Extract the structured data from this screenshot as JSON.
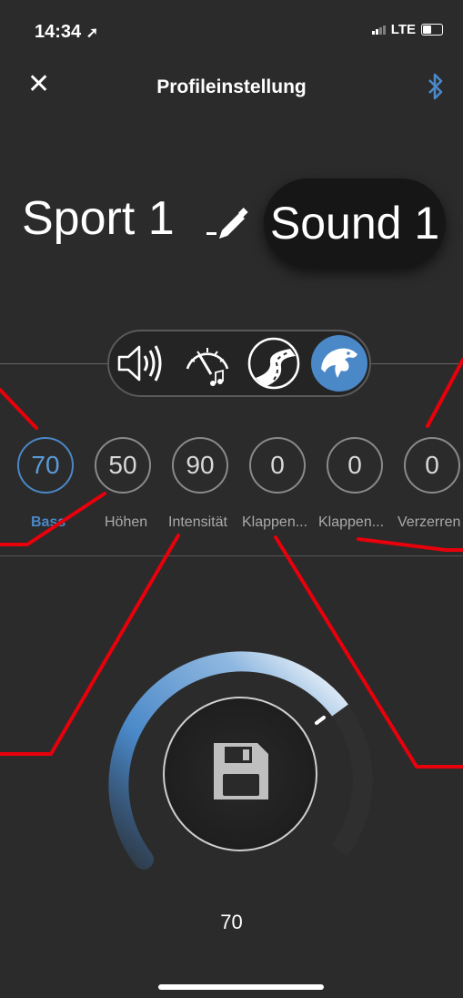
{
  "status_bar": {
    "time": "14:34",
    "network": "LTE"
  },
  "header": {
    "title": "Profileinstellung",
    "close_icon": "close-icon",
    "bluetooth_icon": "bluetooth-icon"
  },
  "profile": {
    "name": "Sport 1",
    "sound": "Sound 1"
  },
  "modes": [
    {
      "icon": "speaker-icon"
    },
    {
      "icon": "gauge-sound-icon"
    },
    {
      "icon": "road-icon"
    },
    {
      "icon": "panther-icon",
      "active": true
    }
  ],
  "params": [
    {
      "label": "Bass",
      "value": "70",
      "active": true
    },
    {
      "label": "Höhen",
      "value": "50"
    },
    {
      "label": "Intensität",
      "value": "90"
    },
    {
      "label": "Klappen...",
      "value": "0"
    },
    {
      "label": "Klappen...",
      "value": "0"
    },
    {
      "label": "Verzerren",
      "value": "0"
    }
  ],
  "dial": {
    "value": "70",
    "level_percent": 70,
    "center_icon": "save-icon"
  },
  "colors": {
    "background": "#2b2b2b",
    "accent": "#4a88c8",
    "annotation": "#e8000b"
  }
}
